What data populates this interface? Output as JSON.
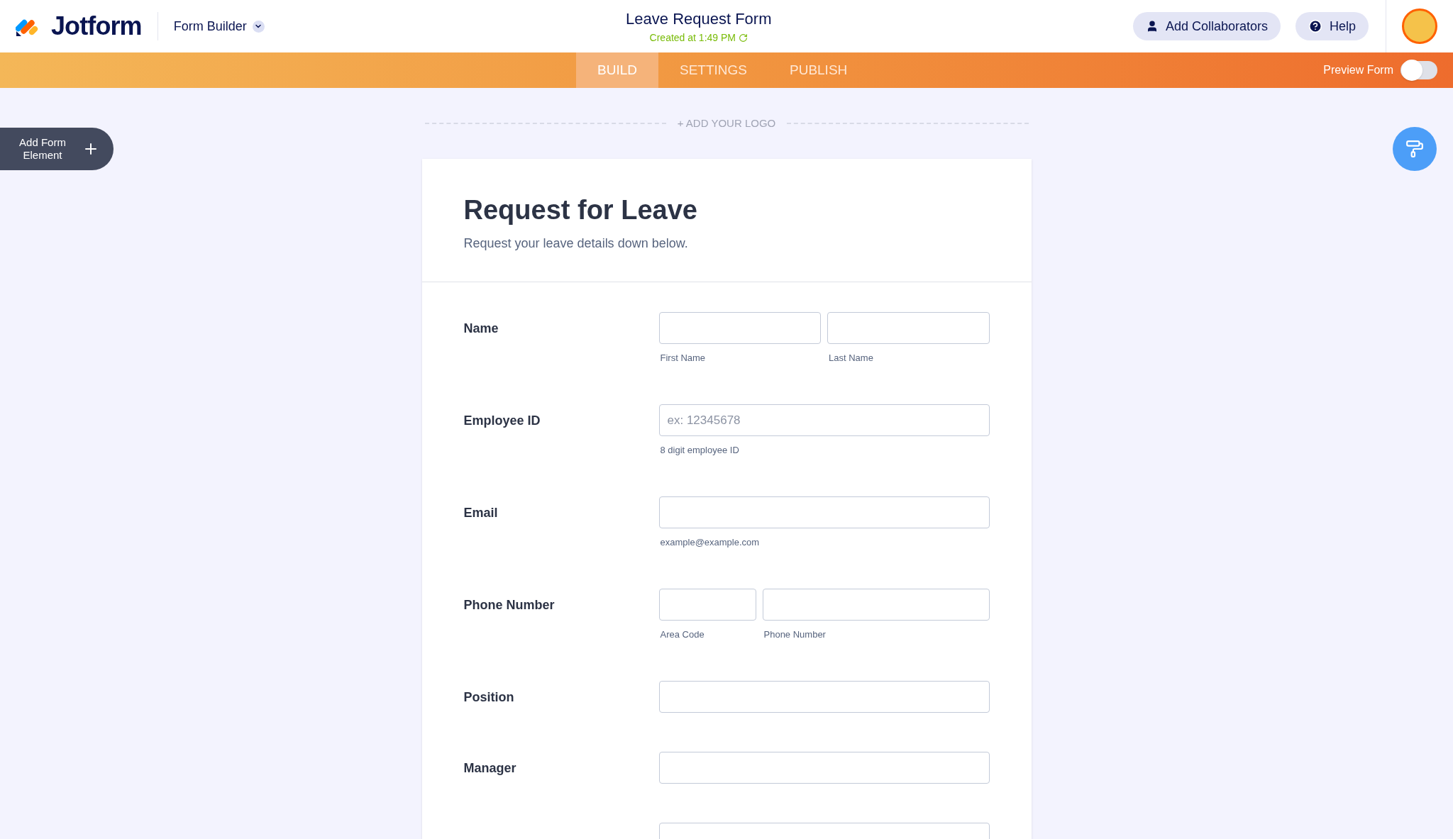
{
  "header": {
    "brand": "Jotform",
    "menu": "Form Builder",
    "title": "Leave Request Form",
    "subtitle": "Created at 1:49 PM",
    "buttons": [
      "Add Collaborators",
      "Help"
    ]
  },
  "tabs": [
    {
      "label": "BUILD",
      "selected": true
    },
    {
      "label": "SETTINGS",
      "selected": false
    },
    {
      "label": "PUBLISH",
      "selected": false
    }
  ],
  "preview": {
    "label": "Preview Form",
    "on": false
  },
  "add_element": "Add Form Element",
  "logo_placeholder": "+ ADD YOUR LOGO",
  "form": {
    "title": "Request for Leave",
    "description": "Request your leave details down below.",
    "fields": [
      {
        "kind": "name",
        "label": "Name",
        "parts": [
          {
            "sublabel": "First Name"
          },
          {
            "sublabel": "Last Name"
          }
        ]
      },
      {
        "kind": "single",
        "label": "Employee ID",
        "placeholder": "ex: 12345678",
        "hint": "8 digit employee ID"
      },
      {
        "kind": "single",
        "label": "Email",
        "hint": "example@example.com"
      },
      {
        "kind": "phone",
        "label": "Phone Number",
        "parts": [
          {
            "sublabel": "Area Code"
          },
          {
            "sublabel": "Phone Number"
          }
        ]
      },
      {
        "kind": "single",
        "label": "Position"
      },
      {
        "kind": "single",
        "label": "Manager"
      },
      {
        "kind": "single"
      }
    ]
  }
}
